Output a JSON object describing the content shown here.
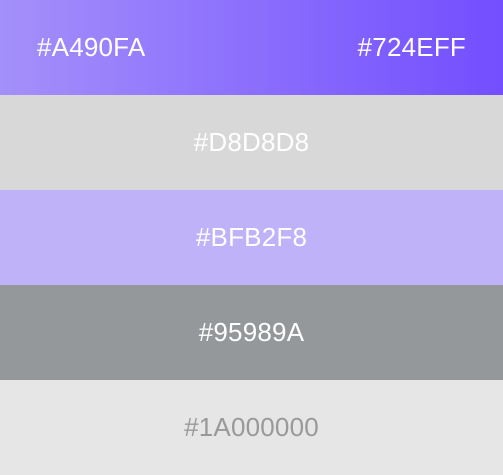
{
  "swatches": {
    "gradient": {
      "start_label": "#A490FA",
      "end_label": "#724EFF",
      "start_color": "#A490FA",
      "end_color": "#724EFF"
    },
    "items": [
      {
        "label": "#D8D8D8",
        "color": "#D8D8D8",
        "text_color": "#FFFFFF"
      },
      {
        "label": "#BFB2F8",
        "color": "#BFB2F8",
        "text_color": "#FFFFFF"
      },
      {
        "label": "#95989A",
        "color": "#95989A",
        "text_color": "#FFFFFF"
      },
      {
        "label": "#1A000000",
        "color": "#E6E6E6",
        "text_color": "#999999"
      }
    ]
  }
}
